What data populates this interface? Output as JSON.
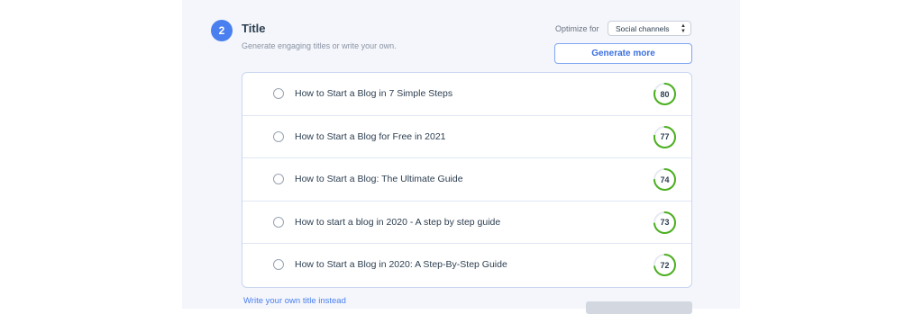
{
  "step": {
    "number": "2",
    "title": "Title",
    "subtitle": "Generate engaging titles or write your own."
  },
  "optimize": {
    "label": "Optimize for",
    "selected": "Social channels"
  },
  "generate_button": "Generate more",
  "titles": [
    {
      "text": "How to Start a Blog in 7 Simple Steps",
      "score": "80",
      "score_fraction": 0.8
    },
    {
      "text": "How to Start a Blog for Free in 2021",
      "score": "77",
      "score_fraction": 0.77
    },
    {
      "text": "How to Start a Blog: The Ultimate Guide",
      "score": "74",
      "score_fraction": 0.74
    },
    {
      "text": "How to start a blog in 2020 - A step by step guide",
      "score": "73",
      "score_fraction": 0.73
    },
    {
      "text": "How to Start a Blog in 2020: A Step-By-Step Guide",
      "score": "72",
      "score_fraction": 0.72
    }
  ],
  "write_own_link": "Write your own title instead",
  "colors": {
    "accent": "#4a7ff0",
    "score_ring": "#4caf1f"
  }
}
